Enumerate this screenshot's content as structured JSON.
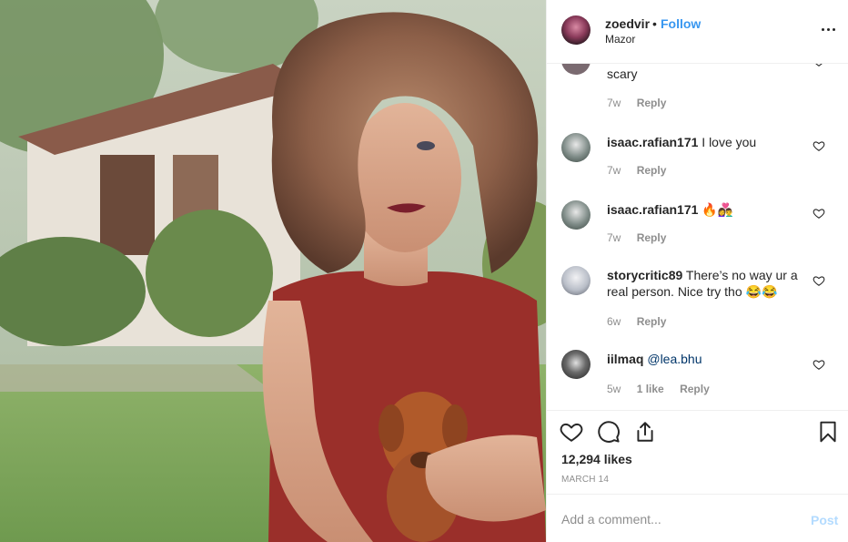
{
  "post": {
    "username": "zoedvir",
    "separator": "•",
    "follow_label": "Follow",
    "location": "Mazor",
    "more_icon": "more-options-icon",
    "photo_description_icon": "post-photo"
  },
  "comments": [
    {
      "username": "",
      "text": "scary",
      "time": "7w",
      "likes": "",
      "reply_label": "Reply",
      "avatar_color": "#7a6a70"
    },
    {
      "username": "isaac.rafian171",
      "text": "I love you",
      "time": "7w",
      "likes": "",
      "reply_label": "Reply",
      "avatar_color": "#9aa4a0"
    },
    {
      "username": "isaac.rafian171",
      "text": "🔥👩‍❤️‍👨",
      "time": "7w",
      "likes": "",
      "reply_label": "Reply",
      "avatar_color": "#9aa4a0"
    },
    {
      "username": "storycritic89",
      "text": "There’s no way ur a real person. Nice try tho 😂😂",
      "time": "6w",
      "likes": "",
      "reply_label": "Reply",
      "avatar_color": "#b9bec8"
    },
    {
      "username": "iilmaq",
      "mention": "@lea.bhu",
      "text": "",
      "time": "5w",
      "likes": "1 like",
      "reply_label": "Reply",
      "avatar_color": "#3a3a3a"
    }
  ],
  "actions": {
    "like_icon": "heart-icon",
    "comment_icon": "comment-icon",
    "share_icon": "share-icon",
    "save_icon": "bookmark-icon",
    "likes_count": "12,294 likes",
    "date": "MARCH 14"
  },
  "composer": {
    "placeholder": "Add a comment...",
    "post_label": "Post"
  },
  "colors": {
    "link": "#3897f0",
    "post_disabled": "#b3dbff",
    "muted": "#8e8e8e",
    "text": "#262626"
  }
}
